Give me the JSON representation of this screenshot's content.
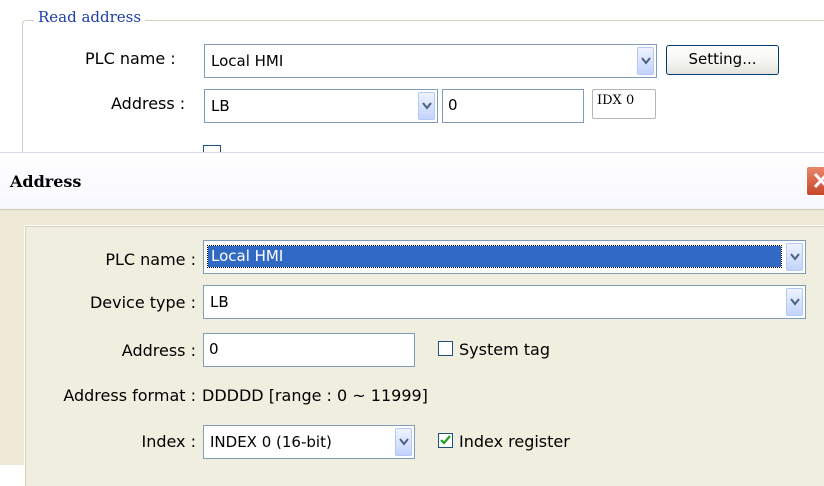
{
  "background": {
    "group_title": "Read address",
    "plc_name_label": "PLC name :",
    "plc_name_value": "Local HMI",
    "setting_button": "Setting...",
    "address_label": "Address :",
    "device_value": "LB",
    "address_value": "0",
    "idx_text": "IDX 0"
  },
  "dialog": {
    "title": "Address",
    "plc_name_label": "PLC name :",
    "plc_name_value": "Local HMI",
    "device_type_label": "Device type :",
    "device_type_value": "LB",
    "address_label": "Address :",
    "address_value": "0",
    "system_tag_label": "System tag",
    "system_tag_checked": false,
    "address_format_label": "Address format :",
    "address_format_value": "DDDDD [range : 0 ~ 11999]",
    "index_label": "Index :",
    "index_value": "INDEX 0 (16-bit)",
    "index_register_label": "Index register",
    "index_register_checked": true
  },
  "colors": {
    "selection": "#316ac5",
    "dialog_bg": "#ede9d6",
    "close_red": "#d8563a",
    "group_title": "#1c3fa8"
  }
}
